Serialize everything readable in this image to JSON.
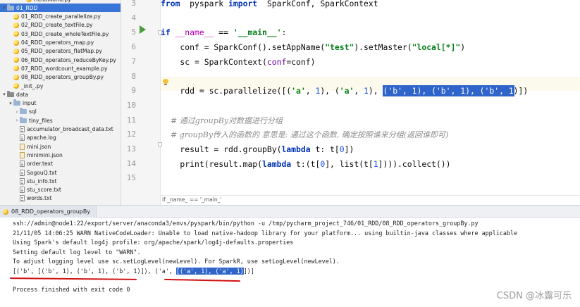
{
  "colors": {
    "accent": "#2f65ca",
    "selection": "#3875d7",
    "annotation_red": "#d11212",
    "keyword": "#0033b3",
    "string": "#067d17",
    "comment": "#8c8c8c"
  },
  "tree": {
    "items": [
      {
        "indent": 3,
        "arrow": "",
        "icon": "python-file-icon",
        "label": "HelloWorld.py"
      },
      {
        "indent": 0,
        "arrow": "v",
        "icon": "folder-icon",
        "label": "01_RDD",
        "selected": true
      },
      {
        "indent": 1,
        "arrow": "",
        "icon": "python-file-icon",
        "label": "01_RDD_create_parallelize.py"
      },
      {
        "indent": 1,
        "arrow": "",
        "icon": "python-file-icon",
        "label": "02_RDD_create_textFile.py"
      },
      {
        "indent": 1,
        "arrow": "",
        "icon": "python-file-icon",
        "label": "03_RDD_create_wholeTextFile.py"
      },
      {
        "indent": 1,
        "arrow": "",
        "icon": "python-file-icon",
        "label": "04_RDD_operators_map.py"
      },
      {
        "indent": 1,
        "arrow": "",
        "icon": "python-file-icon",
        "label": "05_RDD_operators_flatMap.py"
      },
      {
        "indent": 1,
        "arrow": "",
        "icon": "python-file-icon",
        "label": "06_RDD_operators_reduceByKey.py"
      },
      {
        "indent": 1,
        "arrow": "",
        "icon": "python-file-icon",
        "label": "07_RDD_wordcount_example.py"
      },
      {
        "indent": 1,
        "arrow": "",
        "icon": "python-file-icon",
        "label": "08_RDD_operators_groupBy.py"
      },
      {
        "indent": 1,
        "arrow": "",
        "icon": "python-file-icon",
        "label": "_init_.py"
      },
      {
        "indent": 0,
        "arrow": "v",
        "icon": "plain-folder-icon",
        "label": "data"
      },
      {
        "indent": 1,
        "arrow": "v",
        "icon": "folder-icon",
        "label": "input"
      },
      {
        "indent": 2,
        "arrow": ">",
        "icon": "folder-icon",
        "label": "sql"
      },
      {
        "indent": 2,
        "arrow": ">",
        "icon": "folder-icon",
        "label": "tiny_files"
      },
      {
        "indent": 2,
        "arrow": "",
        "icon": "text-file-icon",
        "label": "accumulator_broadcast_data.txt"
      },
      {
        "indent": 2,
        "arrow": "",
        "icon": "text-file-icon",
        "label": "apache.log"
      },
      {
        "indent": 2,
        "arrow": "",
        "icon": "json-file-icon",
        "label": "mini.json"
      },
      {
        "indent": 2,
        "arrow": "",
        "icon": "json-file-icon",
        "label": "minimini.json"
      },
      {
        "indent": 2,
        "arrow": "",
        "icon": "text-file-icon",
        "label": "order.text"
      },
      {
        "indent": 2,
        "arrow": "",
        "icon": "text-file-icon",
        "label": "SogouQ.txt"
      },
      {
        "indent": 2,
        "arrow": "",
        "icon": "text-file-icon",
        "label": "stu_info.txt"
      },
      {
        "indent": 2,
        "arrow": "",
        "icon": "text-file-icon",
        "label": "stu_score.txt"
      },
      {
        "indent": 2,
        "arrow": "",
        "icon": "text-file-icon",
        "label": "words.txt"
      }
    ]
  },
  "editor": {
    "line_numbers": [
      "3",
      "4",
      "5",
      "6",
      "7",
      "8",
      "9",
      "10",
      "11",
      "12",
      "13",
      "14",
      "15"
    ],
    "lines": [
      {
        "n": "3",
        "tokens": [
          [
            "kw",
            "from"
          ],
          [
            "",
            "  pyspark "
          ],
          [
            "kw",
            "import"
          ],
          [
            "",
            "  SparkConf, SparkContext"
          ]
        ]
      },
      {
        "n": "4",
        "tokens": []
      },
      {
        "n": "5",
        "tokens": [
          [
            "kw",
            "if"
          ],
          [
            "",
            " "
          ],
          [
            "dunder",
            "__name__"
          ],
          [
            "",
            " == "
          ],
          [
            "str",
            "'__main__'"
          ],
          [
            "",
            ":"
          ]
        ]
      },
      {
        "n": "6",
        "tokens": [
          [
            "",
            "    conf = SparkConf().setAppName("
          ],
          [
            "str",
            "\"test\""
          ],
          [
            "",
            ").setMaster("
          ],
          [
            "str",
            "\"local[*]\""
          ],
          [
            "",
            ")"
          ]
        ]
      },
      {
        "n": "7",
        "tokens": [
          [
            "",
            "    sc = SparkContext("
          ],
          [
            "param",
            "conf"
          ],
          [
            "",
            "=conf)"
          ]
        ]
      },
      {
        "n": "8",
        "tokens": []
      },
      {
        "n": "9",
        "tokens": [
          [
            "",
            "    rdd = sc.parallelize([("
          ],
          [
            "str",
            "'a'"
          ],
          [
            "",
            ", "
          ],
          [
            "num",
            "1"
          ],
          [
            "",
            "), ("
          ],
          [
            "str",
            "'a'"
          ],
          [
            "",
            ", "
          ],
          [
            "num",
            "1"
          ],
          [
            "",
            "), "
          ],
          [
            "selhl",
            "('b', 1), ('b', 1), ('b', 1"
          ],
          [
            "",
            ")])"
          ]
        ]
      },
      {
        "n": "10",
        "tokens": []
      },
      {
        "n": "11",
        "tokens": [
          [
            "cmt",
            "    # 通过groupBy对数据进行分组"
          ]
        ]
      },
      {
        "n": "12",
        "tokens": [
          [
            "cmt",
            "    # groupBy传入的函数的 意思是: 通过这个函数, 确定按照谁来分组(返回谁即可)"
          ]
        ]
      },
      {
        "n": "13",
        "tokens": [
          [
            "",
            "    result = rdd.groupBy("
          ],
          [
            "kw",
            "lambda"
          ],
          [
            "",
            " t: t["
          ],
          [
            "num",
            "0"
          ],
          [
            "",
            "])"
          ]
        ]
      },
      {
        "n": "14",
        "tokens": [
          [
            "",
            "    print(result.map("
          ],
          [
            "kw",
            "lambda"
          ],
          [
            "",
            " t:(t["
          ],
          [
            "num",
            "0"
          ],
          [
            "",
            "], list(t["
          ],
          [
            "num",
            "1"
          ],
          [
            "",
            "]))).collect())"
          ]
        ]
      },
      {
        "n": "15",
        "tokens": []
      }
    ],
    "breadcrumb": "if _name_ == '_main_'"
  },
  "run": {
    "tab_label": "08_RDD_operators_groupBy",
    "lines": [
      "ssh://admin@node1:22/export/server/anaconda3/envs/pyspark/bin/python -u /tmp/pycharm_project_746/01_RDD/08_RDD_operators_groupBy.py",
      "21/11/05 14:06:25 WARN NativeCodeLoader: Unable to load native-hadoop library for your platform... using builtin-java classes where applicable",
      "Using Spark's default log4j profile: org/apache/spark/log4j-defaults.properties",
      "Setting default log level to \"WARN\".",
      "To adjust logging level use sc.setLogLevel(newLevel). For SparkR, use setLogLevel(newLevel)."
    ],
    "result_prefix": "[('b', [('b', 1), ('b', 1), ('b', 1)]), ('a', ",
    "result_highlight": "[('a', 1), ('a', 1)",
    "result_suffix": "])]",
    "finished": "Process finished with exit code 0"
  },
  "watermark": "CSDN @冰露可乐"
}
